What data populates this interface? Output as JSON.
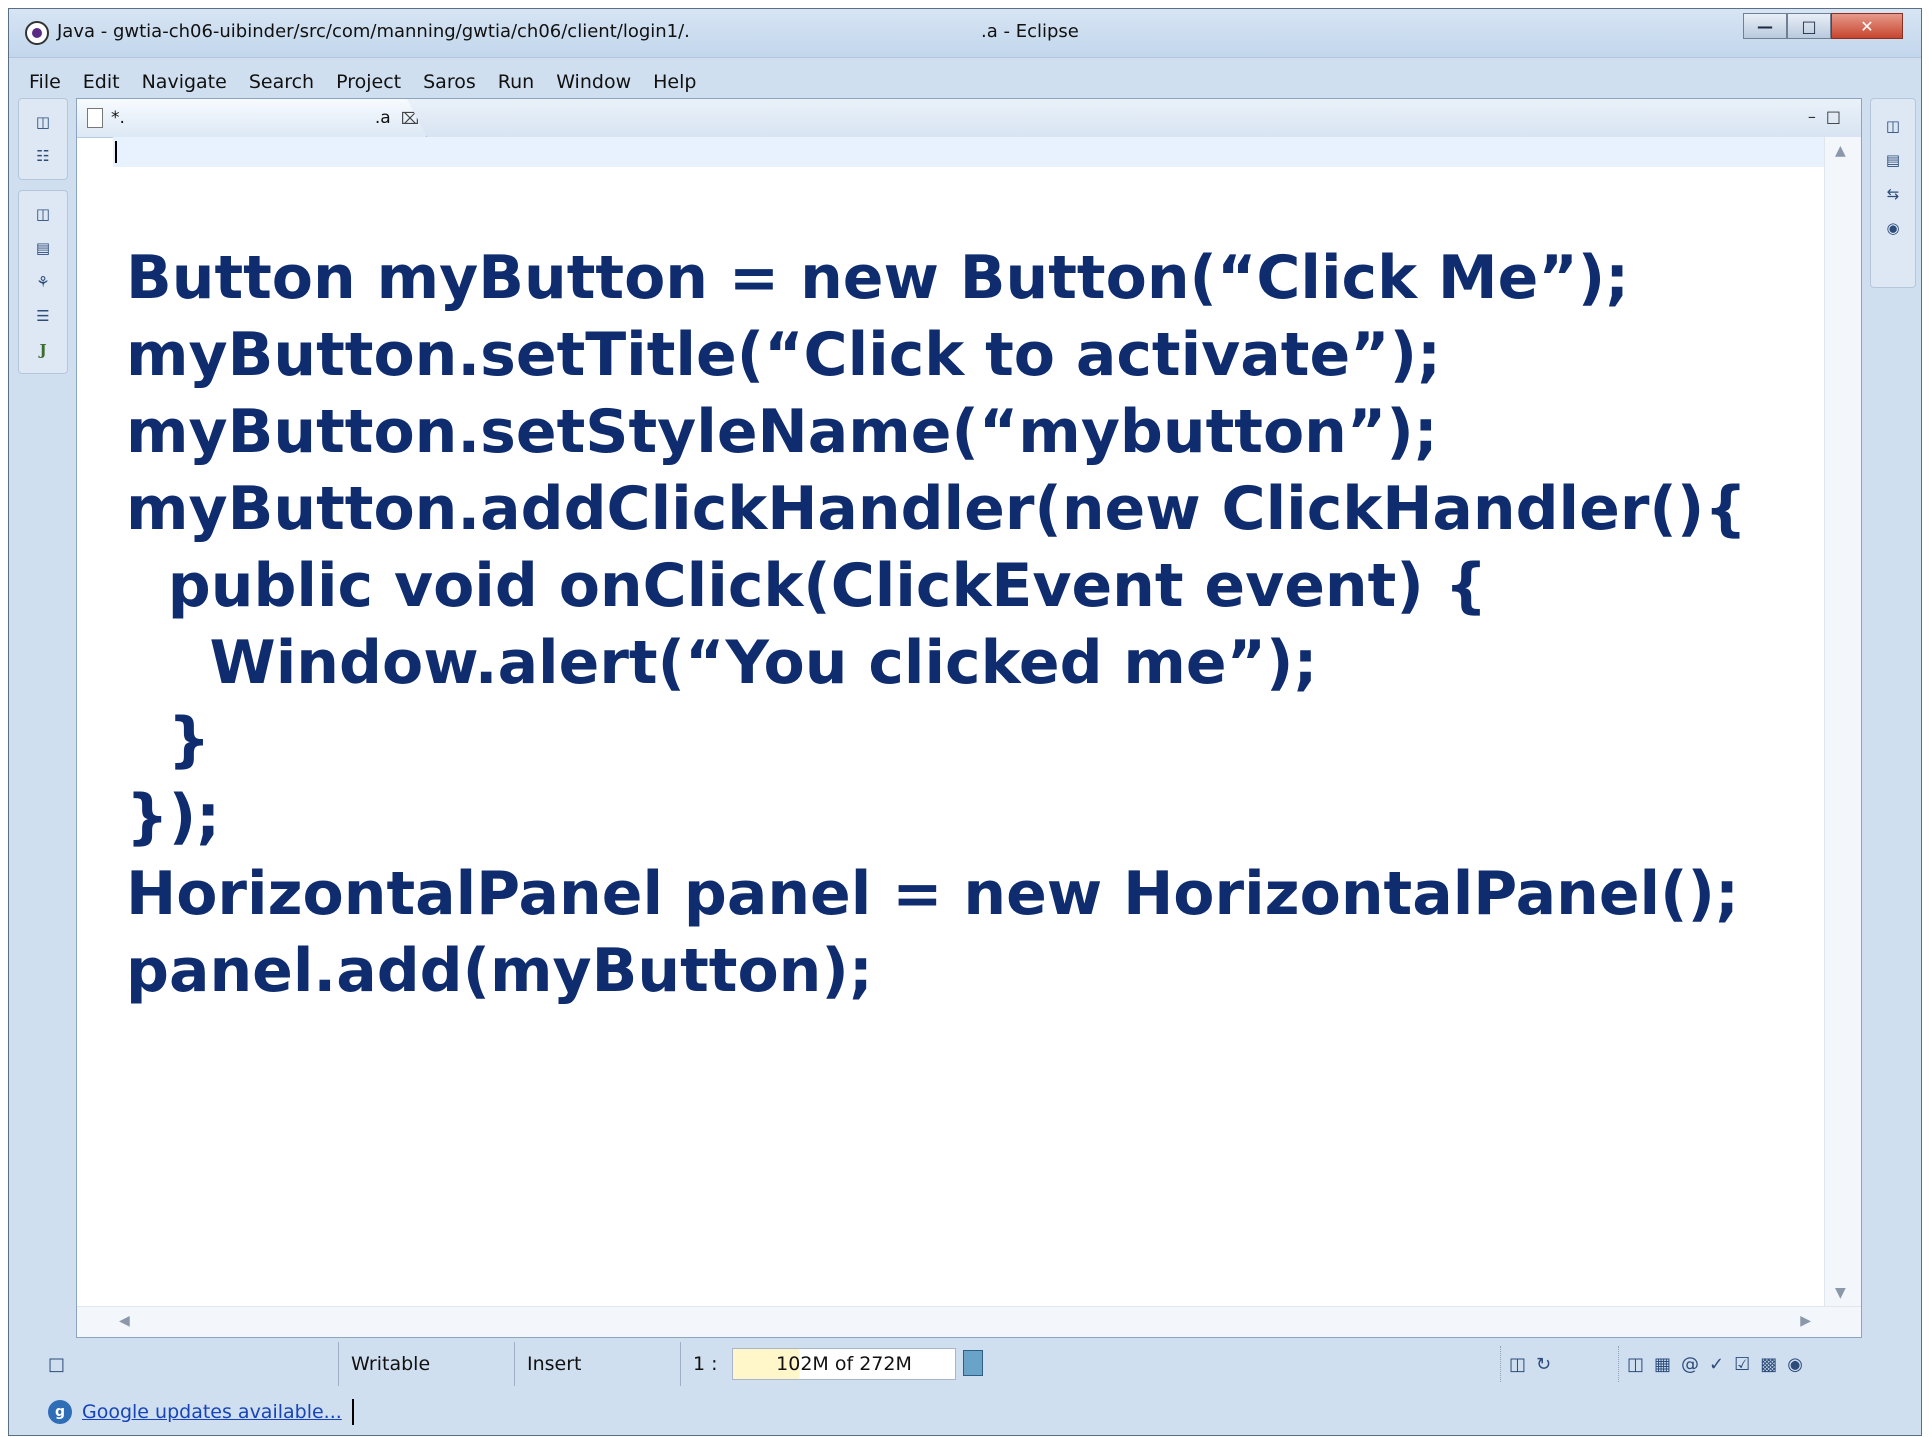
{
  "window": {
    "title": "Java - gwtia-ch06-uibinder/src/com/manning/gwtia/ch06/client/login1/.",
    "title_suffix": ".a - Eclipse",
    "controls": [
      "minimize",
      "maximize",
      "close"
    ]
  },
  "menu": [
    "File",
    "Edit",
    "Navigate",
    "Search",
    "Project",
    "Saros",
    "Run",
    "Window",
    "Help"
  ],
  "editor": {
    "tab_label": "*.",
    "tab_label_suffix": ".a",
    "code_lines": [
      "Button myButton = new Button(“Click Me”);",
      "myButton.setTitle(“Click to activate”);",
      "myButton.setStyleName(“mybutton”);",
      "myButton.addClickHandler(new ClickHandler(){",
      "  public void onClick(ClickEvent event) {",
      "    Window.alert(“You clicked me”);",
      "  }",
      "});",
      "HorizontalPanel panel = new HorizontalPanel();",
      "panel.add(myButton);"
    ]
  },
  "status": {
    "writable": "Writable",
    "insert_mode": "Insert",
    "position": "1 :",
    "heap": "102M of 272M"
  },
  "updates": {
    "text": "Google updates available..."
  },
  "colors": {
    "code": "#0f2c6e",
    "current_line": "#e8f2fe",
    "frame": "#cfdff0"
  }
}
